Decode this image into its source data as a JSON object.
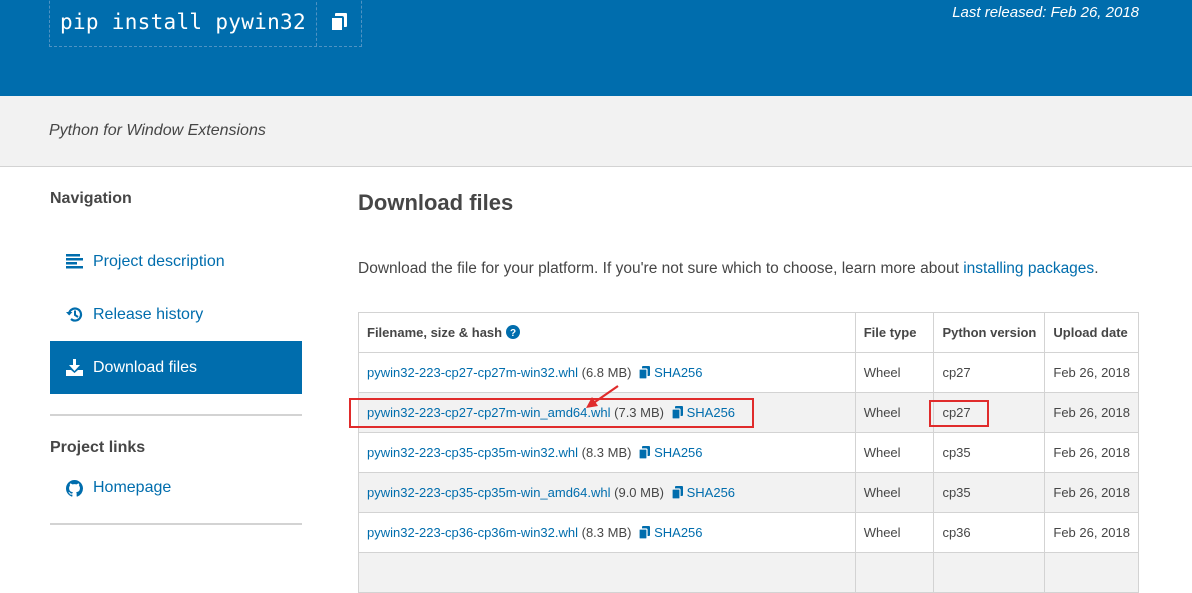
{
  "header": {
    "pip_command": "pip install pywin32",
    "last_released": "Last released: Feb 26, 2018"
  },
  "summary": "Python for Window Extensions",
  "sidebar": {
    "navigation_heading": "Navigation",
    "nav_items": [
      {
        "label": "Project description",
        "icon": "align-left-icon"
      },
      {
        "label": "Release history",
        "icon": "history-icon"
      },
      {
        "label": "Download files",
        "icon": "download-icon",
        "active": true
      }
    ],
    "project_links_heading": "Project links",
    "links": [
      {
        "label": "Homepage",
        "icon": "github-icon"
      }
    ]
  },
  "main": {
    "title": "Download files",
    "intro_text": "Download the file for your platform. If you're not sure which to choose, learn more about ",
    "intro_link": "installing packages",
    "intro_end": "."
  },
  "table": {
    "headers": [
      "Filename, size & hash",
      "File type",
      "Python version",
      "Upload date"
    ],
    "rows": [
      {
        "filename": "pywin32-223-cp27-cp27m-win32.whl",
        "size": "(6.8 MB)",
        "hash": "SHA256",
        "type": "Wheel",
        "python": "cp27",
        "date": "Feb 26, 2018"
      },
      {
        "filename": "pywin32-223-cp27-cp27m-win_amd64.whl",
        "size": "(7.3 MB)",
        "hash": "SHA256",
        "type": "Wheel",
        "python": "cp27",
        "date": "Feb 26, 2018"
      },
      {
        "filename": "pywin32-223-cp35-cp35m-win32.whl",
        "size": "(8.3 MB)",
        "hash": "SHA256",
        "type": "Wheel",
        "python": "cp35",
        "date": "Feb 26, 2018"
      },
      {
        "filename": "pywin32-223-cp35-cp35m-win_amd64.whl",
        "size": "(9.0 MB)",
        "hash": "SHA256",
        "type": "Wheel",
        "python": "cp35",
        "date": "Feb 26, 2018"
      },
      {
        "filename": "pywin32-223-cp36-cp36m-win32.whl",
        "size": "(8.3 MB)",
        "hash": "SHA256",
        "type": "Wheel",
        "python": "cp36",
        "date": "Feb 26, 2018"
      }
    ]
  },
  "colors": {
    "brand_blue": "#006dad",
    "annotation_red": "#e02b2b"
  }
}
